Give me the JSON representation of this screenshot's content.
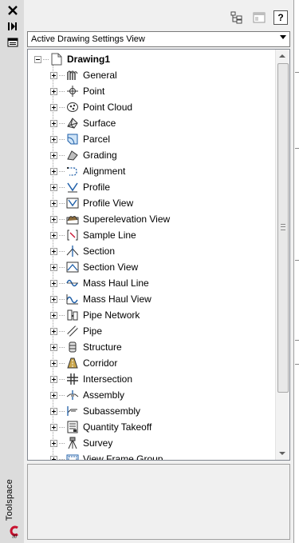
{
  "palette": {
    "title": "Toolspace"
  },
  "view_selector": {
    "selected": "Active Drawing Settings View"
  },
  "toolbar": {
    "help_label": "?"
  },
  "tree": {
    "root": {
      "label": "Drawing1",
      "icon": "drawing-icon"
    },
    "items": [
      {
        "label": "General",
        "icon": "general-icon"
      },
      {
        "label": "Point",
        "icon": "point-icon"
      },
      {
        "label": "Point Cloud",
        "icon": "point-cloud-icon"
      },
      {
        "label": "Surface",
        "icon": "surface-icon"
      },
      {
        "label": "Parcel",
        "icon": "parcel-icon"
      },
      {
        "label": "Grading",
        "icon": "grading-icon"
      },
      {
        "label": "Alignment",
        "icon": "alignment-icon"
      },
      {
        "label": "Profile",
        "icon": "profile-icon"
      },
      {
        "label": "Profile View",
        "icon": "profile-view-icon"
      },
      {
        "label": "Superelevation View",
        "icon": "superelevation-view-icon"
      },
      {
        "label": "Sample Line",
        "icon": "sample-line-icon"
      },
      {
        "label": "Section",
        "icon": "section-icon"
      },
      {
        "label": "Section View",
        "icon": "section-view-icon"
      },
      {
        "label": "Mass Haul Line",
        "icon": "mass-haul-line-icon"
      },
      {
        "label": "Mass Haul View",
        "icon": "mass-haul-view-icon"
      },
      {
        "label": "Pipe Network",
        "icon": "pipe-network-icon"
      },
      {
        "label": "Pipe",
        "icon": "pipe-icon"
      },
      {
        "label": "Structure",
        "icon": "structure-icon"
      },
      {
        "label": "Corridor",
        "icon": "corridor-icon"
      },
      {
        "label": "Intersection",
        "icon": "intersection-icon"
      },
      {
        "label": "Assembly",
        "icon": "assembly-icon"
      },
      {
        "label": "Subassembly",
        "icon": "subassembly-icon"
      },
      {
        "label": "Quantity Takeoff",
        "icon": "quantity-takeoff-icon"
      },
      {
        "label": "Survey",
        "icon": "survey-icon"
      },
      {
        "label": "View Frame Group",
        "icon": "view-frame-group-icon"
      }
    ]
  }
}
